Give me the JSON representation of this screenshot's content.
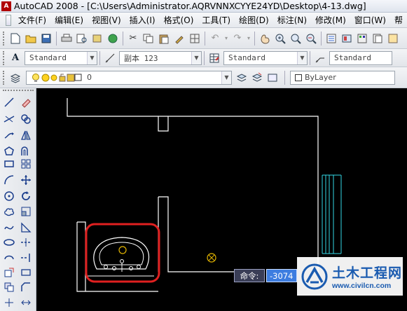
{
  "window": {
    "app_icon_label": "A",
    "title": "AutoCAD 2008 - [C:\\Users\\Administrator.AQRVNNXCYYE24YD\\Desktop\\4-13.dwg]"
  },
  "menubar": {
    "items": [
      "文件(F)",
      "编辑(E)",
      "视图(V)",
      "插入(I)",
      "格式(O)",
      "工具(T)",
      "绘图(D)",
      "标注(N)",
      "修改(M)",
      "窗口(W)",
      "帮"
    ]
  },
  "styles_toolbar": {
    "text_style": "Standard",
    "dim_style": "副本 123",
    "table_style": "Standard",
    "multileader_style": "Standard"
  },
  "layers_toolbar": {
    "current_layer": "0",
    "color_value": "ByLayer"
  },
  "command_line": {
    "label": "命令:",
    "input_value": "-3074"
  },
  "watermark": {
    "title": "土木工程网",
    "url": "www.civilcn.com"
  },
  "colors": {
    "drawing_background": "#000000",
    "linework": "#ffffff",
    "cyan_lines": "#33d8e6",
    "highlight_circle": "#e02020",
    "point_marker": "#e2b400"
  }
}
